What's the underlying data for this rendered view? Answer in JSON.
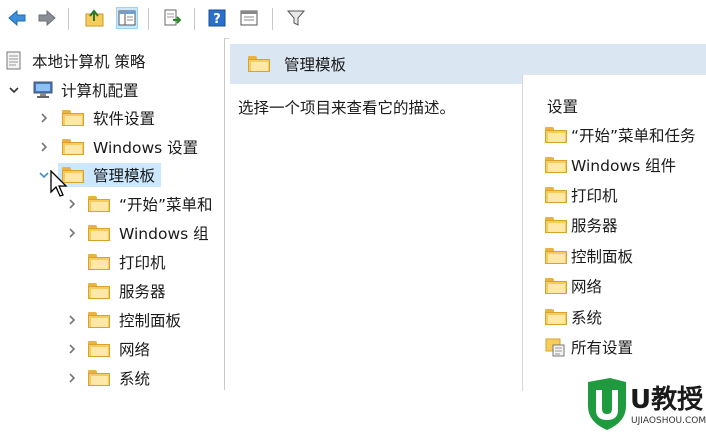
{
  "toolbar": {
    "icons": [
      "back-arrow-icon",
      "forward-arrow-icon",
      "up-folder-icon",
      "show-hide-tree-icon",
      "export-list-icon",
      "help-icon",
      "properties-view-icon",
      "filter-icon"
    ]
  },
  "tree": {
    "root": "本地计算机 策略",
    "computer_config": "计算机配置",
    "software_settings": "软件设置",
    "windows_settings": "Windows 设置",
    "admin_templates": "管理模板",
    "children": [
      "“开始”菜单和",
      "Windows 组",
      "打印机",
      "服务器",
      "控制面板",
      "网络",
      "系统"
    ]
  },
  "pane": {
    "title": "管理模板",
    "description": "选择一个项目来查看它的描述。",
    "column_header": "设置",
    "items": [
      "“开始”菜单和任务",
      "Windows 组件",
      "打印机",
      "服务器",
      "控制面板",
      "网络",
      "系统",
      "所有设置"
    ]
  },
  "watermark": {
    "brand": "U教授",
    "url": "UJIAOSHOU.COM"
  },
  "colors": {
    "selection": "#cce8ff",
    "pane_header": "#dbe6f3",
    "folder": "#f6cc5c"
  }
}
